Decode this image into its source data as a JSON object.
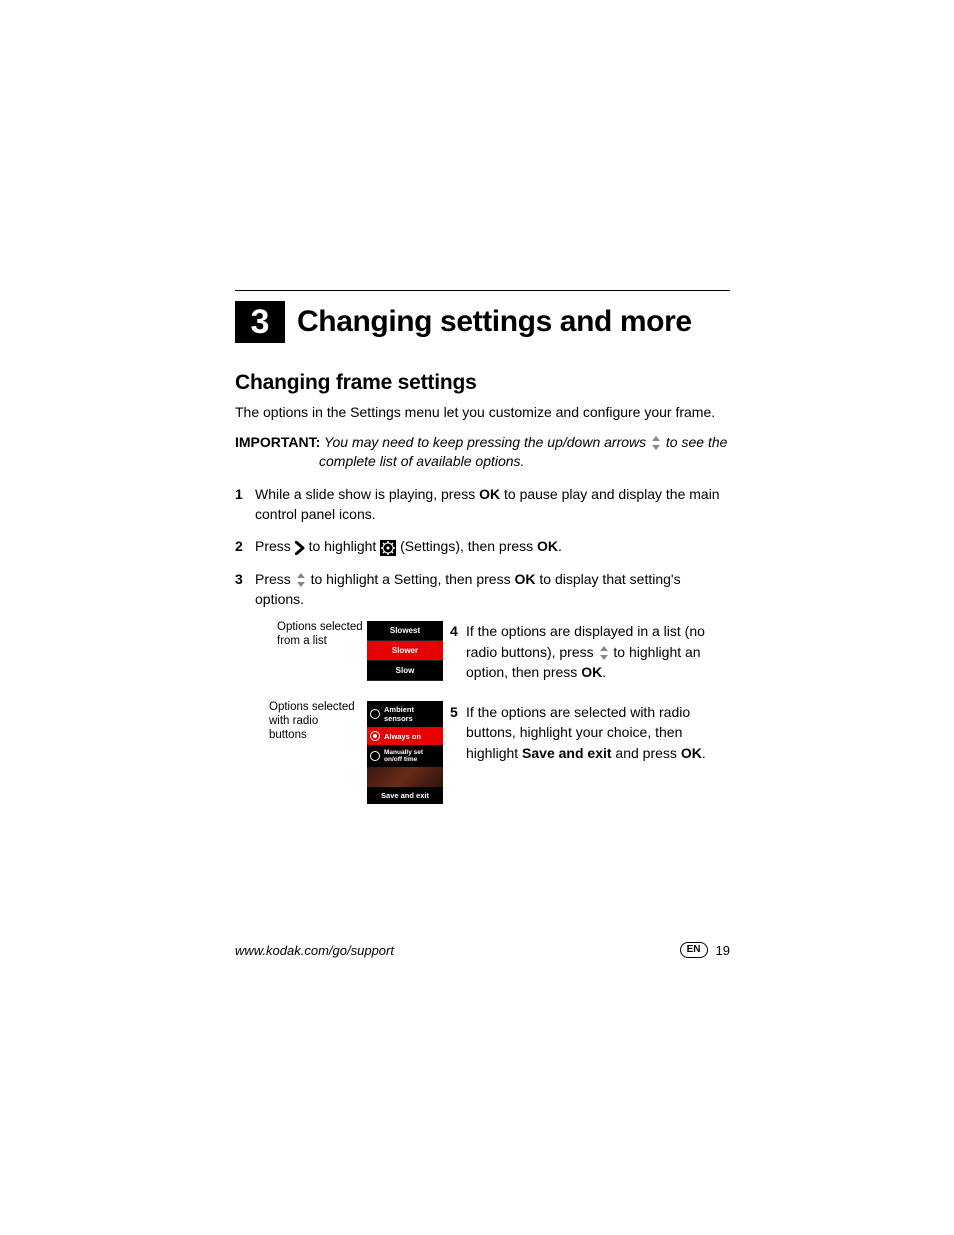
{
  "chapter": {
    "number": "3",
    "title": "Changing settings and more"
  },
  "section": {
    "title": "Changing frame settings"
  },
  "intro": "The options in the Settings menu let you customize and configure your frame.",
  "important": {
    "label": "IMPORTANT:",
    "line1": "You may need to keep pressing the up/down arrows",
    "line1b": "to see the",
    "line2": "complete list of available options."
  },
  "steps": {
    "s1": {
      "num": "1",
      "a": "While a slide show is playing, press ",
      "ok": "OK",
      "b": " to pause play and display the main control panel icons."
    },
    "s2": {
      "num": "2",
      "a": "Press ",
      "b": " to highlight ",
      "c": " (Settings), then press ",
      "ok": "OK",
      "d": "."
    },
    "s3": {
      "num": "3",
      "a": "Press ",
      "b": " to highlight a Setting, then press ",
      "ok": "OK",
      "c": " to display that setting's options."
    },
    "s4": {
      "num": "4",
      "a": "If the options are displayed in a list (no radio buttons), press ",
      "b": " to highlight an option, then press ",
      "ok": "OK",
      "c": "."
    },
    "s5": {
      "num": "5",
      "a": "If the options are selected with radio buttons, highlight your choice, then highlight ",
      "bold": "Save and exit",
      "b": " and press ",
      "ok": "OK",
      "c": "."
    }
  },
  "annotations": {
    "list": "Options selected from a list",
    "radio": "Options selected with radio buttons"
  },
  "list_panel": {
    "r1": "Slowest",
    "r2": "Slower",
    "r3": "Slow"
  },
  "radio_panel": {
    "r1": "Ambient sensors",
    "r2": "Always on",
    "r3": "Manually set on/off time",
    "save": "Save and exit"
  },
  "footer": {
    "url": "www.kodak.com/go/support",
    "lang": "EN",
    "page": "19"
  }
}
